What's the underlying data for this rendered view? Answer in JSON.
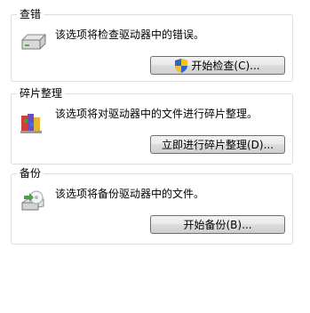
{
  "sections": [
    {
      "title": "查错",
      "description": "该选项将检查驱动器中的错误。",
      "button_label": "开始检查(C)...",
      "icon": "drive-icon",
      "button_icon": "uac-shield-icon"
    },
    {
      "title": "碎片整理",
      "description": "该选项将对驱动器中的文件进行碎片整理。",
      "button_label": "立即进行碎片整理(D)...",
      "icon": "defrag-icon"
    },
    {
      "title": "备份",
      "description": "该选项将备份驱动器中的文件。",
      "button_label": "开始备份(B)...",
      "icon": "backup-icon"
    }
  ]
}
